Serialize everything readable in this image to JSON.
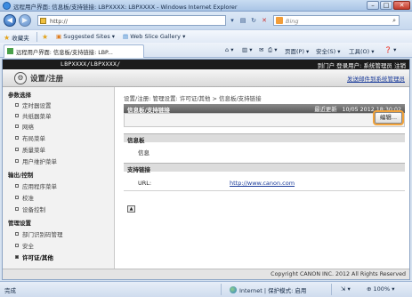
{
  "window": {
    "title": "远程用户界面: 信息板/支持链接: LBPXXXX: LBPXXXX - Windows Internet Explorer",
    "minimize": "–",
    "maximize": "□",
    "close": "✕"
  },
  "address": {
    "back": "◀",
    "forward": "▶",
    "url": "http://",
    "dropdown": "▾",
    "refresh": "↻",
    "stop": "✕",
    "search_placeholder": "Bing",
    "search_go": "⌕"
  },
  "favorites": {
    "label": "收藏夹",
    "items": [
      "Suggested Sites ▾",
      "Web Slice Gallery ▾"
    ]
  },
  "tab": {
    "label": "远程用户界面: 信息板/支持链接: LBP...",
    "commands": [
      "页面(P) ▾",
      "安全(S) ▾",
      "工具(O) ▾",
      "❓ ▾"
    ]
  },
  "app": {
    "model": "LBPXXXX/LBPXXXX/",
    "header_right": "到门户  登录用户: 系统管理员  注销",
    "mode_title": "设置/注册",
    "mail_link": "发送邮件到系统管理员"
  },
  "sidebar": {
    "groups": [
      {
        "label": "参数选择",
        "items": [
          "定时器设置",
          "共纸器菜单",
          "网络",
          "布局菜单",
          "质量菜单",
          "用户维护菜单"
        ]
      },
      {
        "label": "输出/控制",
        "items": [
          "应用程序菜单",
          "校准",
          "设备控制"
        ]
      },
      {
        "label": "管理设置",
        "items": [
          "部门识别码管理",
          "安全",
          "许可证/其他"
        ]
      }
    ],
    "active_item": "许可证/其他"
  },
  "content": {
    "breadcrumb": "设置/注册: 管理设置: 许可证/其他 > 信息板/支持链接",
    "panel_title": "信息板/支持链接",
    "last_updated_label": "最近更新",
    "last_updated": "10/05 2012 18:30:02",
    "edit_button": "编辑...",
    "info_board_title": "信息板",
    "info_board_label": "信息",
    "support_title": "支持链接",
    "url_label": "URL:",
    "url_value": "http://www.canon.com",
    "top_button": "▲"
  },
  "footer": {
    "copyright": "Copyright CANON INC. 2012 All Rights Reserved"
  },
  "status": {
    "left": "完成",
    "zone": "Internet | 保护模式: 启用",
    "zoom": "100%"
  }
}
